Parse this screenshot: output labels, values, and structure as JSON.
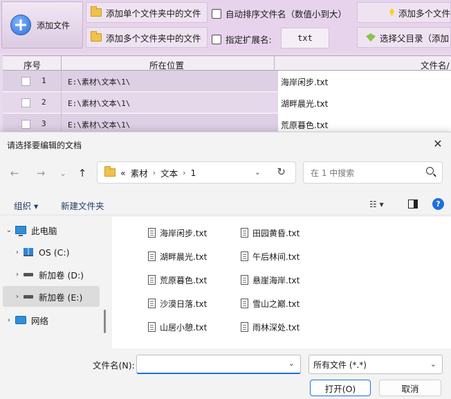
{
  "toolbar": {
    "add_file_label": "添加文件",
    "add_single_folder_label": "添加单个文件夹中的文件",
    "add_multi_folder_label": "添加多个文件夹中的文件",
    "auto_sort_label": "自动排序文件名（数值小到大）",
    "ext_label": "指定扩展名:",
    "ext_value": "txt",
    "add_multi_files_label": "添加多个文件",
    "select_parent_label": "选择父目录（添加"
  },
  "grid": {
    "headers": {
      "index": "序号",
      "location": "所在位置",
      "filename": "文件名/"
    },
    "rows": [
      {
        "num": "1",
        "path": "E:\\素材\\文本\\1\\",
        "name": "海岸闲步.txt"
      },
      {
        "num": "2",
        "path": "E:\\素材\\文本\\1\\",
        "name": "湖畔晨光.txt"
      },
      {
        "num": "3",
        "path": "E:\\素材\\文本\\1\\",
        "name": "荒原暮色.txt"
      }
    ]
  },
  "dialog": {
    "title": "请选择要编辑的文档",
    "close_glyph": "✕",
    "nav": {
      "back": "←",
      "forward": "→",
      "recent": "⌄",
      "up": "↑"
    },
    "address": {
      "overflow": "«",
      "crumbs": [
        "素材",
        "文本",
        "1"
      ],
      "sep": "›"
    },
    "search_placeholder": "在 1 中搜索",
    "commands": {
      "organize": "组织 ▾",
      "new_folder": "新建文件夹",
      "view": "☷ ▾"
    },
    "help_glyph": "?",
    "tree": [
      {
        "label": "此电脑",
        "chev": "⌄",
        "icon": "pc-icon"
      },
      {
        "label": "OS (C:)",
        "chev": "›",
        "icon": "windows-drive-icon"
      },
      {
        "label": "新加卷 (D:)",
        "chev": "›",
        "icon": "drive-icon"
      },
      {
        "label": "新加卷 (E:)",
        "chev": "›",
        "icon": "drive-icon",
        "selected": true
      },
      {
        "label": "网络",
        "chev": "›",
        "icon": "network-icon"
      }
    ],
    "files_col1": [
      "海岸闲步.txt",
      "湖畔晨光.txt",
      "荒原暮色.txt",
      "沙漠日落.txt",
      "山居小憩.txt"
    ],
    "files_col2": [
      "田园黄昏.txt",
      "午后林间.txt",
      "悬崖海岸.txt",
      "雪山之巅.txt",
      "雨林深处.txt"
    ],
    "filename_label": "文件名(N):",
    "filename_value": "",
    "filetype_value": "所有文件 (*.*)",
    "open_label": "打开(O)",
    "cancel_label": "取消"
  },
  "colors": {
    "accent": "#1f6fdc",
    "app_bg": "#e9d9ee"
  }
}
